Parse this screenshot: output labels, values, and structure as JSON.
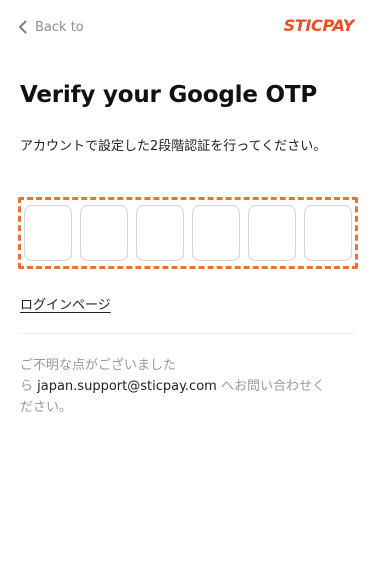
{
  "header": {
    "back_label": "Back to",
    "brand": "STICPAY"
  },
  "main": {
    "title": "Verify your Google OTP",
    "instruction": "アカウントで設定した2段階認証を行ってください。",
    "otp_digits": [
      "",
      "",
      "",
      "",
      "",
      ""
    ],
    "login_link": "ログインページ"
  },
  "support": {
    "line1": "ご不明な点がございました",
    "prefix": "ら ",
    "email": "japan.support@sticpay.com",
    "line2_rest": " へお問い合わせく",
    "line3": "ださい。"
  },
  "colors": {
    "accent": "#f04e23",
    "frame": "#e8733a",
    "muted_text": "#9a9a9a"
  }
}
